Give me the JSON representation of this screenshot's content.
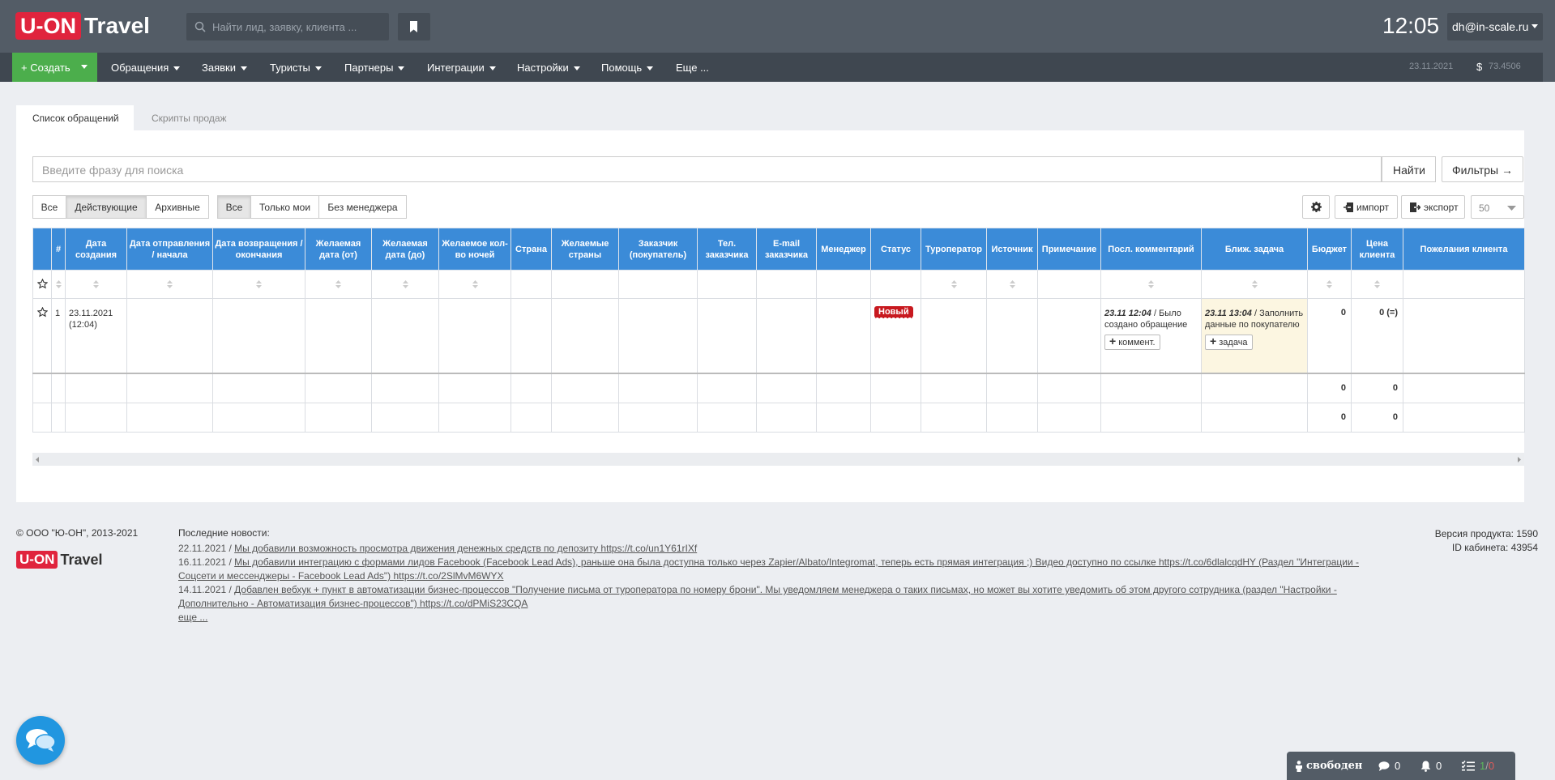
{
  "header": {
    "logo_left": "U-ON",
    "logo_right": "Travel",
    "search_placeholder": "Найти лид, заявку, клиента ...",
    "clock": "12:05",
    "user_email": "dh@in-scale.ru"
  },
  "nav": {
    "create": "Создать",
    "items": [
      "Обращения",
      "Заявки",
      "Туристы",
      "Партнеры",
      "Интеграции",
      "Настройки",
      "Помощь",
      "Еще ..."
    ],
    "date": "23.11.2021",
    "currency_symbol": "$",
    "rate": "73.4506"
  },
  "tabs": {
    "active": "Список обращений",
    "inactive": "Скрипты продаж"
  },
  "search": {
    "placeholder": "Введите фразу для поиска",
    "find": "Найти",
    "filters": "Фильтры →"
  },
  "filters": {
    "group1": [
      "Все",
      "Действующие",
      "Архивные"
    ],
    "group1_active": "Действующие",
    "group2": [
      "Все",
      "Только мои",
      "Без менеджера"
    ],
    "group2_active": "Все",
    "import": "импорт",
    "export": "экспорт",
    "per_page": "50"
  },
  "table": {
    "columns": [
      "",
      "#",
      "Дата создания",
      "Дата отправления / начала",
      "Дата возвращения / окончания",
      "Желаемая дата (от)",
      "Желаемая дата (до)",
      "Желаемое кол-во ночей",
      "Страна",
      "Желаемые страны",
      "Заказчик (покупатель)",
      "Тел. заказчика",
      "E-mail заказчика",
      "Менеджер",
      "Статус",
      "Туроператор",
      "Источник",
      "Примечание",
      "Посл. комментарий",
      "Ближ. задача",
      "Бюджет",
      "Цена клиента",
      "Пожелания клиента"
    ],
    "row": {
      "num": "1",
      "created": "23.11.2021",
      "created_time": "(12:04)",
      "status": "Новый",
      "comment_date": "23.11 12:04",
      "comment_text": " / Было создано обращение",
      "comment_btn": "коммент.",
      "task_date": "23.11 13:04",
      "task_text": " / Заполнить данные по покупателю",
      "task_btn": "задача",
      "budget": "0",
      "price": "0 (=)"
    },
    "totals": [
      {
        "budget": "0",
        "price": "0"
      },
      {
        "budget": "0",
        "price": "0"
      }
    ]
  },
  "footer": {
    "copyright": "© ООО \"Ю-ОН\", 2013-2021",
    "news_title": "Последние новости:",
    "news": [
      {
        "date": "22.11.2021 / ",
        "text": "Мы добавили возможность просмотра движения денежных средств по депозиту https://t.co/un1Y61rIXf"
      },
      {
        "date": "16.11.2021 / ",
        "text": "Мы добавили интеграцию с формами лидов Facebook (Facebook Lead Ads), раньше она была доступна только через Zapier/Albato/Integromat, теперь есть прямая интеграция ;) Видео доступно по ссылке https://t.co/6dlalcqdHY (Раздел \"Интеграции - Соцсети и мессенджеры - Facebook Lead Ads\") https://t.co/2SlMvM6WYX"
      },
      {
        "date": "14.11.2021 / ",
        "text": "Добавлен вебхук + пункт в автоматизации бизнес-процессов \"Получение письма от туроператора по номеру брони\". Мы уведомляем менеджера о таких письмах, но может вы хотите уведомить об этом другого сотрудника (раздел \"Настройки - Дополнительно - Автоматизация бизнес-процессов\") https://t.co/dPMiS23CQA"
      }
    ],
    "more": "еще ...",
    "version": "Версия продукта: 1590",
    "cabinet": "ID кабинета: 43954"
  },
  "status_bar": {
    "status": "свободен",
    "messages": "0",
    "notifications": "0",
    "tasks_done": "1",
    "tasks_sep": " / ",
    "tasks_overdue": "0"
  }
}
